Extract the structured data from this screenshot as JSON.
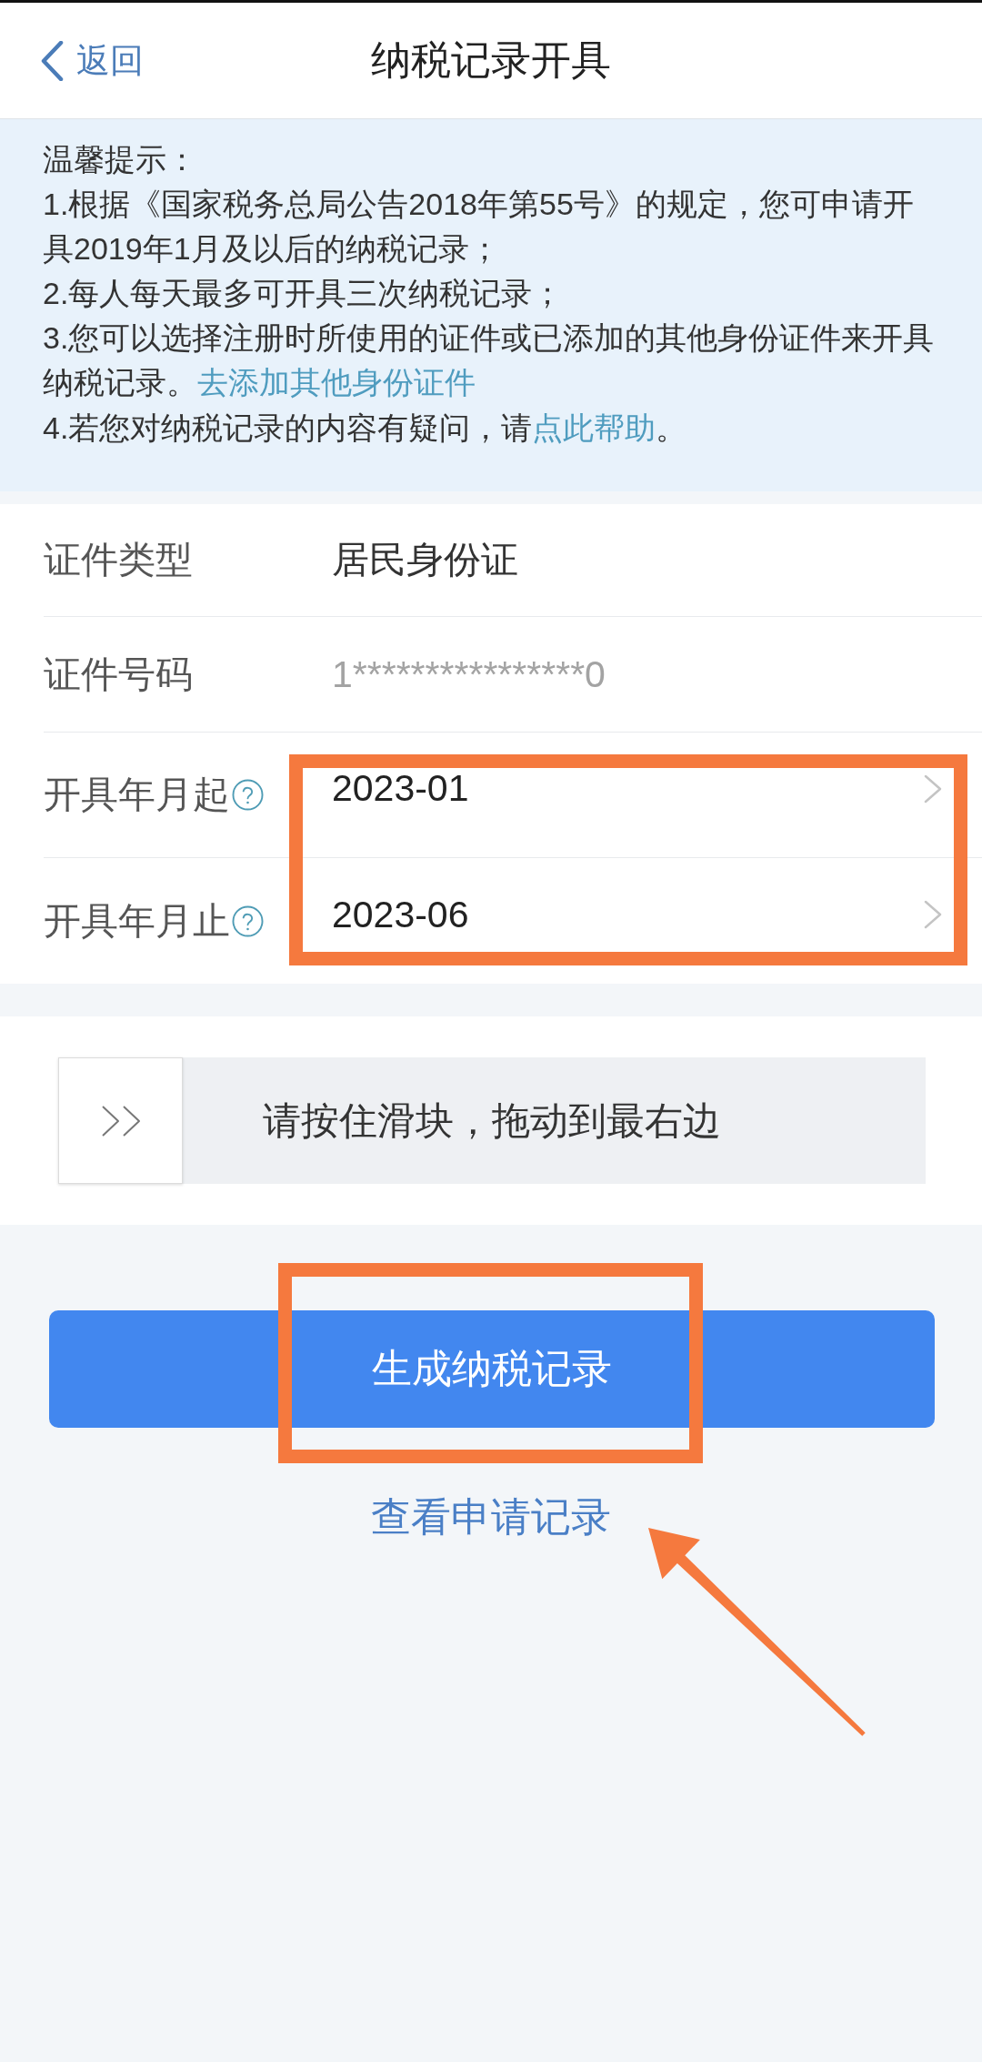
{
  "nav": {
    "back_label": "返回",
    "title": "纳税记录开具"
  },
  "notice": {
    "heading": "温馨提示：",
    "items": [
      {
        "text": "1.根据《国家税务总局公告2018年第55号》的规定，您可申请开具2019年1月及以后的纳税记录；"
      },
      {
        "text": "2.每人每天最多可开具三次纳税记录；"
      },
      {
        "text": "3.您可以选择注册时所使用的证件或已添加的其他身份证件来开具纳税记录。",
        "link": "去添加其他身份证件"
      },
      {
        "text": "4.若您对纳税记录的内容有疑问，请",
        "link": "点此帮助",
        "after": "。"
      }
    ]
  },
  "form": {
    "rows": [
      {
        "kind": "text",
        "label": "证件类型",
        "value": "居民身份证"
      },
      {
        "kind": "masked",
        "label": "证件号码",
        "value": "1****************0"
      },
      {
        "kind": "picker",
        "label": "开具年月起",
        "value": "2023-01"
      },
      {
        "kind": "picker",
        "label": "开具年月止",
        "value": "2023-06"
      }
    ]
  },
  "slider": {
    "hint": "请按住滑块，拖动到最右边",
    "level": 0
  },
  "primary_button": {
    "label": "生成纳税记录"
  },
  "secondary_link": {
    "label": "查看申请记录"
  }
}
